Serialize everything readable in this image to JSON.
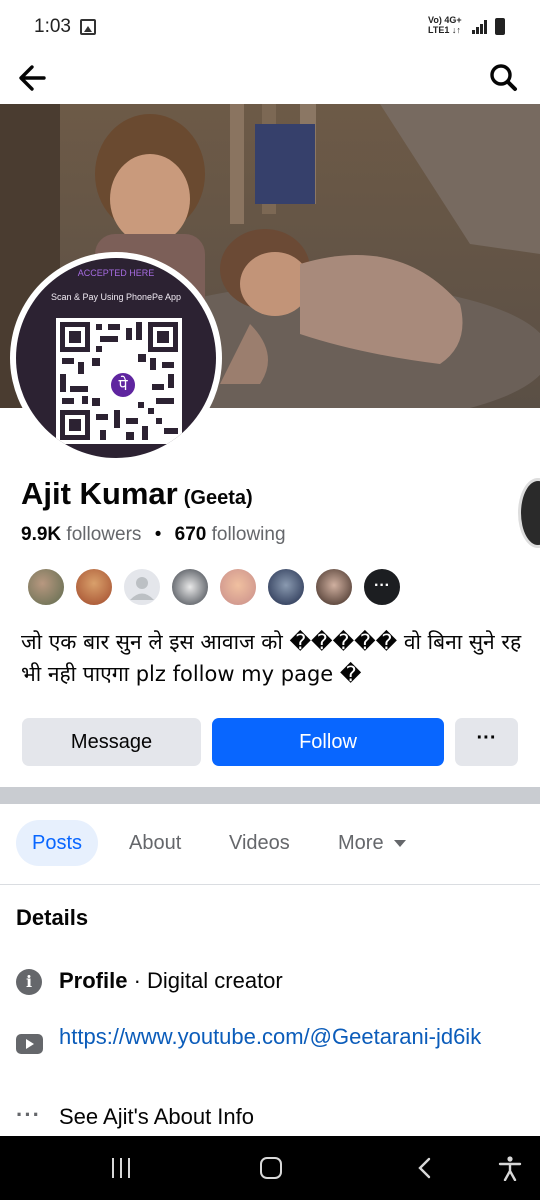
{
  "status_bar": {
    "time": "1:03",
    "network_top": "Vo) 4G+",
    "network_bottom": "LTE1 ↓↑"
  },
  "topbar": {
    "back_icon": "back-arrow-icon",
    "search_icon": "search-icon"
  },
  "cover": {
    "qr_accepted": "ACCEPTED HERE",
    "qr_scan": "Scan & Pay Using PhonePe App",
    "qr_logo": "पे"
  },
  "profile": {
    "name": "Ajit Kumar",
    "alt_name": "(Geeta)",
    "followers_count": "9.9K",
    "followers_label": "followers",
    "separator": "•",
    "following_count": "670",
    "following_label": "following",
    "bio": "जो एक बार सुन ले इस आवाज को ����� वो बिना सुने रह भी नही पाएगा plz follow my page �"
  },
  "actions": {
    "message": "Message",
    "follow": "Follow",
    "more": "···"
  },
  "tabs": [
    {
      "label": "Posts"
    },
    {
      "label": "About"
    },
    {
      "label": "Videos"
    },
    {
      "label": "More"
    }
  ],
  "details": {
    "title": "Details",
    "profile_label": "Profile",
    "profile_value": " · Digital creator",
    "link": "https://www.youtube.com/@Geetarani-jd6ik",
    "about_info": "See Ajit's About Info"
  },
  "colors": {
    "accent": "#0866ff",
    "button_gray": "#e4e6eb",
    "link": "#0b5cba"
  }
}
